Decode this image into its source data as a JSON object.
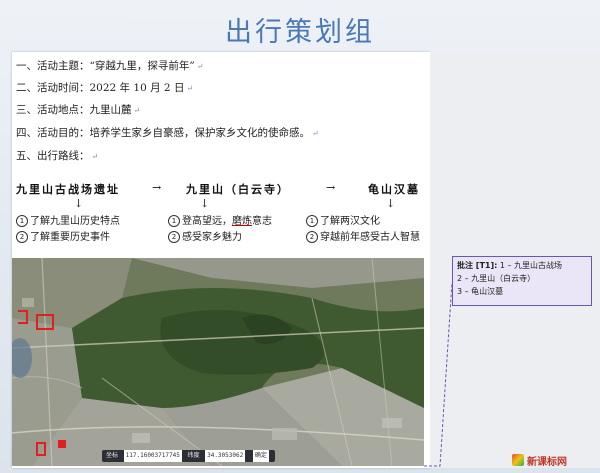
{
  "slide": {
    "title": "出行策划组"
  },
  "doc": {
    "lines": [
      "一、活动主题：“穿越九里，探寻前年”",
      "二、活动时间：2022 年 10 月 2 日",
      "三、活动地点：九里山麓",
      "四、活动目的：培养学生家乡自豪感，保护家乡文化的使命感。",
      "五、出行路线："
    ],
    "route": {
      "stops": [
        "九里山古战场遗址",
        "九里山（白云寺）",
        "龟山汉墓"
      ],
      "arrow": "→",
      "down_arrow": "↓",
      "stop1_items": [
        "了解九里山历史特点",
        "了解重要历史事件"
      ],
      "stop2_items_a": "登高望远，",
      "stop2_items_a_hl": "磨炼",
      "stop2_items_a_tail": "意志",
      "stop2_item_b": "感受家乡魅力",
      "stop3_items": [
        "了解两汉文化",
        "穿越前年感受古人智慧"
      ]
    }
  },
  "map": {
    "status_label": "坐标",
    "coord_x": "117.16003717745",
    "coord_y_label": "纬度",
    "coord_y": "34.3053062",
    "status_btn": "确定"
  },
  "comment": {
    "label": "批注 [T1]:",
    "lines": [
      "1 – 九里山古战场",
      "2 – 九里山（白云寺）",
      "3 – 龟山汉墓"
    ]
  },
  "watermark": {
    "text": "新课标网"
  },
  "colors": {
    "title": "#4a79b6",
    "comment_border": "#6a55b8",
    "marker_red": "#e0201c"
  }
}
